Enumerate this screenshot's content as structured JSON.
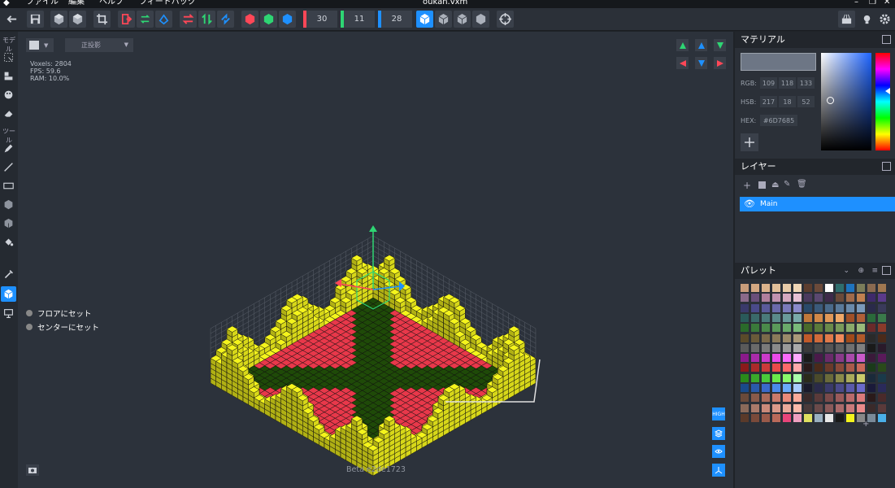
{
  "menubar": {
    "items": [
      "ファイル",
      "編集",
      "ヘルプ",
      "フィードバック"
    ],
    "title": "oukan.vxm"
  },
  "toolbar": {
    "counts": {
      "red": "30",
      "green": "11",
      "blue": "28"
    },
    "colors": {
      "red": "#ff4757",
      "green": "#2ed573",
      "blue": "#1e90ff",
      "accent": "#1e90ff"
    }
  },
  "lefttool": {
    "head_model": "モデル",
    "head_tool": "ツール"
  },
  "viewport": {
    "projection_label": "正投影",
    "stats": {
      "voxels": "Voxels: 2804",
      "fps": "FPS: 59.6",
      "ram": "RAM: 10.0%"
    },
    "context_menu": [
      "フロアにセット",
      "センターにセット"
    ],
    "build_label": "Beta e2de1723",
    "quality_label": "HIGH",
    "model_colors": {
      "yellow": "#f4f41c",
      "red": "#e8384a",
      "dark_green": "#1f4a08"
    }
  },
  "material": {
    "title": "マテリアル",
    "rgb_label": "RGB:",
    "rgb": [
      "109",
      "118",
      "133"
    ],
    "hsb_label": "HSB:",
    "hsb": [
      "217",
      "18",
      "52"
    ],
    "hex_label": "HEX:",
    "hex": "#6D7685",
    "swatch": "#6d7685"
  },
  "layers": {
    "title": "レイヤー",
    "items": [
      {
        "name": "Main",
        "visible": true,
        "selected": true
      }
    ]
  },
  "palette": {
    "title": "パレット",
    "rows": [
      [
        "#c89c7a",
        "#d4a882",
        "#dbb38c",
        "#e2c09a",
        "#e8cba8",
        "#efd6b6",
        "#5c3d2e",
        "#6b4a3a",
        "#ffffff",
        "#2f6e6e",
        "#1e73be",
        "#7b7d5a",
        "#8a6a50",
        "#a07850"
      ],
      [
        "#8a6a8a",
        "#6a4f7a",
        "#b07f9c",
        "#c093b0",
        "#d4a8c0",
        "#e6c0d4",
        "#4b3a5e",
        "#5a4870",
        "#3e2a4a",
        "#6a4a3a",
        "#a06a4a",
        "#c08050",
        "#3e2a6a",
        "#5a3a8a"
      ],
      [
        "#3a3a6a",
        "#4a4a8a",
        "#5a5a9a",
        "#6a6aaa",
        "#7a7aba",
        "#8a8aca",
        "#2a4a6a",
        "#3a5a7a",
        "#4a6a8a",
        "#5a7a9a",
        "#6a8aaa",
        "#7a9aba",
        "#2a2a4a",
        "#3a3a5a"
      ],
      [
        "#2a5a5a",
        "#3a6a6a",
        "#4a7a7a",
        "#5a8a8a",
        "#6a9a9a",
        "#7aaaaa",
        "#c0783a",
        "#d08848",
        "#e09858",
        "#f0a868",
        "#a05028",
        "#b06038",
        "#2a6a3a",
        "#3a7a4a"
      ],
      [
        "#2a6a2a",
        "#3a7a3a",
        "#4a8a4a",
        "#5a9a5a",
        "#6aaa6a",
        "#7aba7a",
        "#4a6a2a",
        "#5a7a3a",
        "#6a8a4a",
        "#7a9a5a",
        "#8aaa6a",
        "#9aba7a",
        "#6a2a2a",
        "#8a3a2a"
      ],
      [
        "#5a4a2a",
        "#6a5a3a",
        "#7a6a4a",
        "#8a7a5a",
        "#9a8a6a",
        "#aa9a7a",
        "#c05a2a",
        "#d06a3a",
        "#e07a4a",
        "#f08a5a",
        "#a04a1a",
        "#b05a2a",
        "#2a2a2a",
        "#4a2a1a"
      ],
      [
        "#5a5a5a",
        "#6a6a6a",
        "#7a7a7a",
        "#8a8a8a",
        "#9a9a9a",
        "#aaaaaa",
        "#3a3a3a",
        "#4a4a4a",
        "#555555",
        "#606060",
        "#707070",
        "#808080",
        "#1a1a1a",
        "#2a1a2a"
      ],
      [
        "#8a1a8a",
        "#aa2aaa",
        "#ca3aca",
        "#ea4aea",
        "#fa6afa",
        "#ffaaff",
        "#1a1a1a",
        "#4a1a4a",
        "#6a2a6a",
        "#8a3a8a",
        "#aa4aaa",
        "#ca5aca",
        "#3a1a3a",
        "#5a1a5a"
      ],
      [
        "#8a1a1a",
        "#aa2a2a",
        "#ca3a3a",
        "#ea4a4a",
        "#fa6a6a",
        "#ffaaaa",
        "#2a1a1a",
        "#4a2a1a",
        "#6a3a2a",
        "#8a4a3a",
        "#aa5a4a",
        "#ca6a5a",
        "#1a3a1a",
        "#2a4a1a"
      ],
      [
        "#2a8a1a",
        "#3aaa2a",
        "#4aca3a",
        "#6aea4a",
        "#8afa6a",
        "#aaffaa",
        "#2a2a1a",
        "#4a4a2a",
        "#6a6a3a",
        "#8a8a4a",
        "#aaaa5a",
        "#caca6a",
        "#1a2a3a",
        "#1a3a4a"
      ],
      [
        "#1a4a8a",
        "#2a5aaa",
        "#3a6aca",
        "#4a8aea",
        "#6aaafa",
        "#aaccff",
        "#1a1a2a",
        "#2a2a4a",
        "#3a3a6a",
        "#4a4a8a",
        "#5a5aaa",
        "#6a6aca",
        "#1a1a3a",
        "#2a2a5a"
      ],
      [
        "#6a4a3a",
        "#8a5a4a",
        "#aa6a5a",
        "#ca7a6a",
        "#ea8a7a",
        "#faaa9a",
        "#3a2a2a",
        "#5a3a3a",
        "#7a4a4a",
        "#9a5a5a",
        "#ba6a6a",
        "#da7a7a",
        "#2a1a1a",
        "#4a2a2a"
      ],
      [
        "#8a6a5a",
        "#aa7a6a",
        "#ca8a7a",
        "#da9a8a",
        "#eaaa9a",
        "#fabaaa",
        "#4a3a3a",
        "#6a4a4a",
        "#8a5a5a",
        "#aa6a6a",
        "#ca7a7a",
        "#ea8a8a",
        "#3a2a2a",
        "#5a3a3a"
      ],
      [
        "#5a3a2a",
        "#7a4a3a",
        "#9a5a4a",
        "#ba6a5a",
        "#e8457a",
        "#f0a0c0",
        "#e0e060",
        "#9ab0c0",
        "#e8e8e8",
        "#1a1a1a",
        "#f4f41c",
        "#888888",
        "#7a8a98",
        "#4ab0e8"
      ]
    ]
  }
}
